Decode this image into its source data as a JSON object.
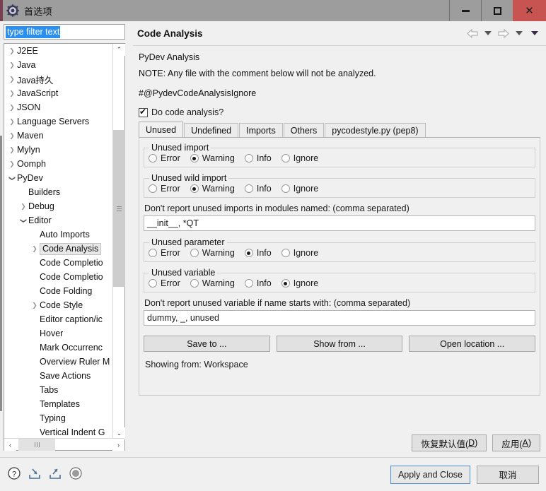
{
  "window": {
    "title": "首选项",
    "title_icon": "gear-icon",
    "controls": {
      "minimize": "minimize-icon",
      "maximize": "maximize-icon",
      "close": "close-icon"
    }
  },
  "sidebar": {
    "filter": {
      "value": "type filter text",
      "placeholder": "type filter text"
    },
    "items": [
      {
        "label": "J2EE",
        "indent": 0,
        "twisty": "collapsed"
      },
      {
        "label": "Java",
        "indent": 0,
        "twisty": "collapsed"
      },
      {
        "label": "Java持久",
        "indent": 0,
        "twisty": "collapsed"
      },
      {
        "label": "JavaScript",
        "indent": 0,
        "twisty": "collapsed"
      },
      {
        "label": "JSON",
        "indent": 0,
        "twisty": "collapsed"
      },
      {
        "label": "Language Servers",
        "indent": 0,
        "twisty": "collapsed"
      },
      {
        "label": "Maven",
        "indent": 0,
        "twisty": "collapsed"
      },
      {
        "label": "Mylyn",
        "indent": 0,
        "twisty": "collapsed"
      },
      {
        "label": "Oomph",
        "indent": 0,
        "twisty": "collapsed"
      },
      {
        "label": "PyDev",
        "indent": 0,
        "twisty": "expanded"
      },
      {
        "label": "Builders",
        "indent": 1,
        "twisty": "none"
      },
      {
        "label": "Debug",
        "indent": 1,
        "twisty": "collapsed"
      },
      {
        "label": "Editor",
        "indent": 1,
        "twisty": "expanded"
      },
      {
        "label": "Auto Imports",
        "indent": 2,
        "twisty": "none"
      },
      {
        "label": "Code Analysis",
        "indent": 2,
        "twisty": "collapsed",
        "selected": true
      },
      {
        "label": "Code Completio",
        "indent": 2,
        "twisty": "none"
      },
      {
        "label": "Code Completio",
        "indent": 2,
        "twisty": "none"
      },
      {
        "label": "Code Folding",
        "indent": 2,
        "twisty": "none"
      },
      {
        "label": "Code Style",
        "indent": 2,
        "twisty": "collapsed"
      },
      {
        "label": "Editor caption/ic",
        "indent": 2,
        "twisty": "none"
      },
      {
        "label": "Hover",
        "indent": 2,
        "twisty": "none"
      },
      {
        "label": "Mark Occurrenc",
        "indent": 2,
        "twisty": "none"
      },
      {
        "label": "Overview Ruler M",
        "indent": 2,
        "twisty": "none"
      },
      {
        "label": "Save Actions",
        "indent": 2,
        "twisty": "none"
      },
      {
        "label": "Tabs",
        "indent": 2,
        "twisty": "none"
      },
      {
        "label": "Templates",
        "indent": 2,
        "twisty": "none"
      },
      {
        "label": "Typing",
        "indent": 2,
        "twisty": "none"
      },
      {
        "label": "Vertical Indent G",
        "indent": 2,
        "twisty": "none"
      }
    ]
  },
  "page": {
    "title": "Code Analysis",
    "nav": {
      "back": "back-arrow-icon",
      "back_menu": "chevron-down-icon",
      "forward": "forward-arrow-icon",
      "forward_menu": "chevron-down-icon",
      "view_menu": "chevron-down-icon"
    },
    "description": {
      "line1": "PyDev Analysis",
      "line2": "NOTE: Any file with the comment below will not be analyzed.",
      "line3": "#@PydevCodeAnalysisIgnore"
    },
    "do_code_analysis": {
      "label": "Do code analysis?",
      "checked": true
    },
    "tabs": [
      {
        "label": "Unused",
        "active": true
      },
      {
        "label": "Undefined",
        "active": false
      },
      {
        "label": "Imports",
        "active": false
      },
      {
        "label": "Others",
        "active": false
      },
      {
        "label": "pycodestyle.py (pep8)",
        "active": false
      }
    ],
    "groups": [
      {
        "legend": "Unused import",
        "options": [
          "Error",
          "Warning",
          "Info",
          "Ignore"
        ],
        "selected": "Warning"
      },
      {
        "legend": "Unused wild import",
        "options": [
          "Error",
          "Warning",
          "Info",
          "Ignore"
        ],
        "selected": "Warning"
      }
    ],
    "modules_field": {
      "label": "Don't report unused imports in modules named: (comma separated)",
      "value": "__init__, *QT"
    },
    "group_param": {
      "legend": "Unused parameter",
      "options": [
        "Error",
        "Warning",
        "Info",
        "Ignore"
      ],
      "selected": "Info"
    },
    "group_variable": {
      "legend": "Unused variable",
      "options": [
        "Error",
        "Warning",
        "Info",
        "Ignore"
      ],
      "selected": "Ignore"
    },
    "variable_field": {
      "label": "Don't report unused variable if name starts with: (comma separated)",
      "value": "dummy, _, unused"
    },
    "action_buttons": [
      "Save to ...",
      "Show from ...",
      "Open location ..."
    ],
    "showing_from": "Showing from: Workspace",
    "restore_defaults": {
      "text": "恢复默认值(",
      "mnemonic": "D",
      "tail": ")"
    },
    "apply": {
      "text": "应用(",
      "mnemonic": "A",
      "tail": ")"
    }
  },
  "footer": {
    "icons": [
      "help-icon",
      "import-icon",
      "export-icon",
      "record-icon"
    ],
    "apply_and_close": "Apply and Close",
    "cancel": "取消"
  }
}
